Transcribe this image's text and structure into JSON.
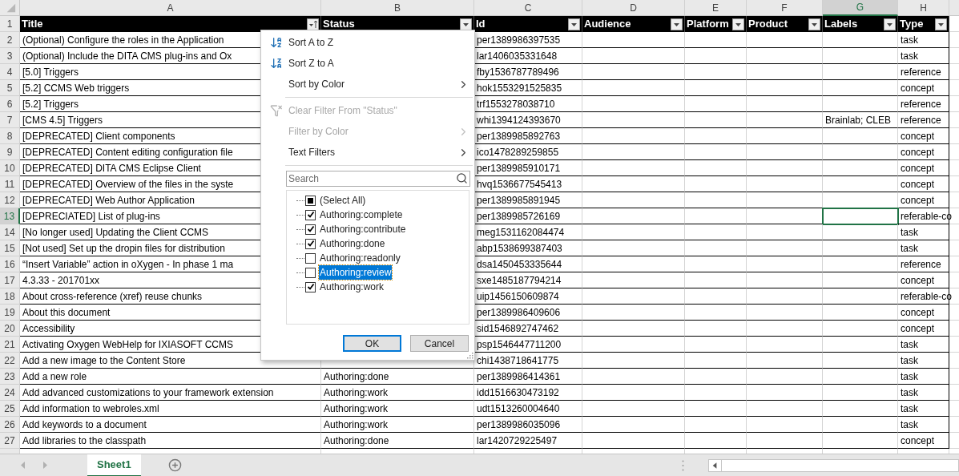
{
  "columns": [
    {
      "letter": "A",
      "header": "Title",
      "selected": false,
      "sorted": true
    },
    {
      "letter": "B",
      "header": "Status",
      "selected": false,
      "sorted": false
    },
    {
      "letter": "C",
      "header": "Id",
      "selected": false,
      "sorted": false
    },
    {
      "letter": "D",
      "header": "Audience",
      "selected": false,
      "sorted": false
    },
    {
      "letter": "E",
      "header": "Platform",
      "selected": false,
      "sorted": false
    },
    {
      "letter": "F",
      "header": "Product",
      "selected": false,
      "sorted": false
    },
    {
      "letter": "G",
      "header": "Labels",
      "selected": true,
      "sorted": false
    },
    {
      "letter": "H",
      "header": "Type",
      "selected": false,
      "sorted": false
    }
  ],
  "header_row": {
    "number": "1",
    "selected": false
  },
  "rows": [
    {
      "number": "2",
      "selected": false,
      "title": "(Optional) Configure the roles in the Application",
      "id": "per1389986397535",
      "type": "task"
    },
    {
      "number": "3",
      "selected": false,
      "title": "(Optional) Include the DITA CMS plug-ins and Ox",
      "id": "lar1406035331648",
      "type": "task"
    },
    {
      "number": "4",
      "selected": false,
      "title": "[5.0] Triggers",
      "id": "fby1536787789496",
      "type": "reference"
    },
    {
      "number": "5",
      "selected": false,
      "title": "[5.2] CCMS Web triggers",
      "id": "hok1553291525835",
      "type": "concept"
    },
    {
      "number": "6",
      "selected": false,
      "title": "[5.2] Triggers",
      "id": "trf1553278038710",
      "type": "reference"
    },
    {
      "number": "7",
      "selected": false,
      "title": "[CMS 4.5] Triggers",
      "id": "whi1394124393670",
      "labels": "Brainlab; CLEB",
      "type": "reference"
    },
    {
      "number": "8",
      "selected": false,
      "title": "[DEPRECATED] Client components",
      "id": "per1389985892763",
      "type": "concept"
    },
    {
      "number": "9",
      "selected": false,
      "title": "[DEPRECATED] Content editing configuration file",
      "id": "ico1478289259855",
      "type": "concept"
    },
    {
      "number": "10",
      "selected": false,
      "title": "[DEPRECATED] DITA CMS Eclipse Client",
      "id": "per1389985910171",
      "type": "concept"
    },
    {
      "number": "11",
      "selected": false,
      "title": "[DEPRECATED] Overview of the files in the syste",
      "id": "hvq1536677545413",
      "type": "concept"
    },
    {
      "number": "12",
      "selected": false,
      "title": "[DEPRECATED] Web Author Application",
      "id": "per1389985891945",
      "type": "concept"
    },
    {
      "number": "13",
      "selected": true,
      "title": "[DEPRECIATED] List of plug-ins",
      "id": "per1389985726169",
      "type": "referable-co"
    },
    {
      "number": "14",
      "selected": false,
      "title": "[No longer used] Updating the Client CCMS",
      "id": "meg1531162084474",
      "type": "task"
    },
    {
      "number": "15",
      "selected": false,
      "title": "[Not used] Set up the dropin files for distribution",
      "id": "abp1538699387403",
      "type": "task"
    },
    {
      "number": "16",
      "selected": false,
      "title": "“Insert Variable” action in oXygen - In phase 1 ma",
      "id": "dsa1450453335644",
      "type": "reference"
    },
    {
      "number": "17",
      "selected": false,
      "title": "4.3.33 - 201701xx",
      "id": "sxe1485187794214",
      "type": "concept"
    },
    {
      "number": "18",
      "selected": false,
      "title": "About cross-reference (xref) reuse chunks",
      "id": "uip1456150609874",
      "type": "referable-co"
    },
    {
      "number": "19",
      "selected": false,
      "title": "About this document",
      "id": "per1389986409606",
      "type": "concept"
    },
    {
      "number": "20",
      "selected": false,
      "title": "Accessibility",
      "id": "sid1546892747462",
      "type": "concept"
    },
    {
      "number": "21",
      "selected": false,
      "title": "Activating Oxygen WebHelp for IXIASOFT CCMS",
      "id": "psp1546447711200",
      "type": "task"
    },
    {
      "number": "22",
      "selected": false,
      "title": "Add a new image to the Content Store",
      "id": "chi1438718641775",
      "type": "task"
    },
    {
      "number": "23",
      "selected": false,
      "title": "Add a new role",
      "status": "Authoring:done",
      "id": "per1389986414361",
      "type": "task"
    },
    {
      "number": "24",
      "selected": false,
      "title": "Add advanced customizations to your framework extension",
      "status": "Authoring:work",
      "id": "idd1516630473192",
      "type": "task"
    },
    {
      "number": "25",
      "selected": false,
      "title": "Add information to webroles.xml",
      "status": "Authoring:work",
      "id": "udt1513260004640",
      "type": "task"
    },
    {
      "number": "26",
      "selected": false,
      "title": "Add keywords to a document",
      "status": "Authoring:work",
      "id": "per1389986035096",
      "type": "task"
    },
    {
      "number": "27",
      "selected": false,
      "title": "Add libraries to the classpath",
      "status": "Authoring:done",
      "id": "lar1420729225497",
      "type": "concept"
    }
  ],
  "filter_menu": {
    "items": [
      {
        "kind": "sort_az",
        "label": "Sort A to Z",
        "disabled": false,
        "submenu": false
      },
      {
        "kind": "sort_za",
        "label": "Sort Z to A",
        "disabled": false,
        "submenu": false
      },
      {
        "kind": "plain",
        "label": "Sort by Color",
        "disabled": false,
        "submenu": true
      },
      {
        "kind": "separator"
      },
      {
        "kind": "clear",
        "label": "Clear Filter From \"Status\"",
        "disabled": true,
        "submenu": false
      },
      {
        "kind": "plain",
        "label": "Filter by Color",
        "disabled": true,
        "submenu": true
      },
      {
        "kind": "plain",
        "label": "Text Filters",
        "disabled": false,
        "submenu": true
      },
      {
        "kind": "separator"
      }
    ],
    "search": {
      "placeholder": "Search"
    },
    "values": [
      {
        "label": "(Select All)",
        "checked": false,
        "partial": true,
        "selected": false
      },
      {
        "label": "Authoring:complete",
        "checked": true,
        "partial": false,
        "selected": false
      },
      {
        "label": "Authoring:contribute",
        "checked": true,
        "partial": false,
        "selected": false
      },
      {
        "label": "Authoring:done",
        "checked": true,
        "partial": false,
        "selected": false
      },
      {
        "label": "Authoring:readonly",
        "checked": false,
        "partial": false,
        "selected": false
      },
      {
        "label": "Authoring:review",
        "checked": false,
        "partial": false,
        "selected": true
      },
      {
        "label": "Authoring:work",
        "checked": true,
        "partial": false,
        "selected": false
      }
    ],
    "buttons": [
      {
        "label": "OK",
        "default": true
      },
      {
        "label": "Cancel",
        "default": false
      }
    ]
  },
  "sheet_tabs": [
    {
      "label": "Sheet1",
      "selected": true
    }
  ]
}
